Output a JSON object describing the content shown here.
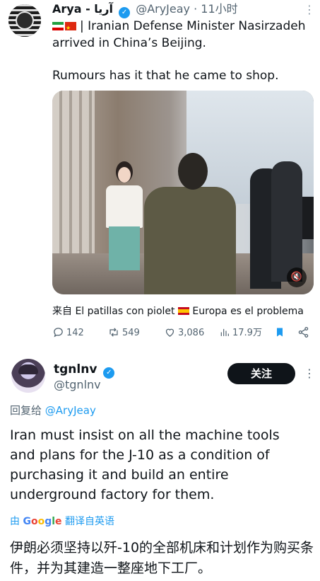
{
  "tweet": {
    "author_name": "Arya - آریا",
    "handle": "@AryJeay",
    "time": "· 11小时",
    "text_line1": "| Iranian Defense Minister Nasirzadeh arrived in China’s Beijing.",
    "text_line2": "Rumours has it that he came to shop.",
    "flags": [
      "flag-iran",
      "flag-china"
    ],
    "attribution": "来自 El patillas con piolet",
    "attribution_suffix": "Europa es el problema",
    "actions": {
      "replies": "142",
      "reposts": "549",
      "likes": "3,086",
      "views": "17.9万"
    }
  },
  "reply": {
    "author_name": "tgnlnv",
    "handle": "@tgnlnv",
    "follow_label": "关注",
    "reply_to_prefix": "回复给",
    "reply_to_mention": "@AryJeay",
    "text": "Iran must insist on all the machine tools and plans for the J-10 as a condition of purchasing it and build an entire underground factory for them.",
    "translate_prefix": "由",
    "translate_brand": [
      "G",
      "o",
      "o",
      "g",
      "l",
      "e"
    ],
    "translate_link": "翻译自英语",
    "translated_text": "伊朗必须坚持以歼-10的全部机床和计划作为购买条件，并为其建造一整座地下工厂。"
  },
  "icons": [
    "verified-badge-icon",
    "more-icon",
    "mute-icon",
    "reply-icon",
    "repost-icon",
    "like-icon",
    "views-icon",
    "bookmark-icon",
    "share-icon"
  ],
  "colors": {
    "accent": "#1d9bf0",
    "text": "#0f1419",
    "muted": "#536471",
    "bookmark": "#1d9bf0"
  }
}
